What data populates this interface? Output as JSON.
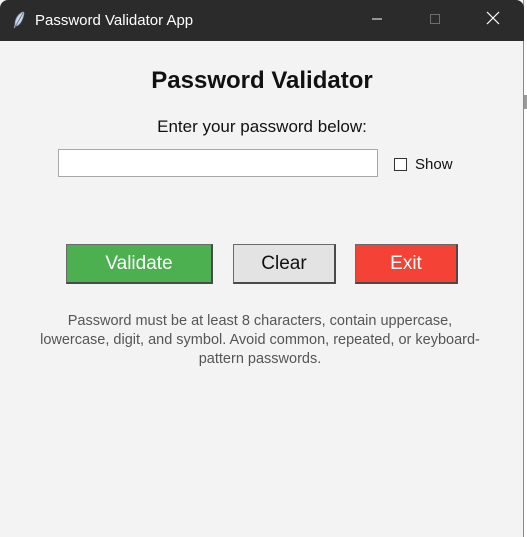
{
  "window": {
    "title": "Password Validator App",
    "icon": "feather-icon",
    "controls": [
      "minimize-icon",
      "maximize-icon",
      "close-icon"
    ]
  },
  "main": {
    "heading": "Password Validator",
    "prompt": "Enter your password below:",
    "password_value": "",
    "show_label": "Show",
    "show_checked": false
  },
  "buttons": {
    "validate": "Validate",
    "clear": "Clear",
    "exit": "Exit"
  },
  "help_text": "Password must be at least 8 characters, contain uppercase, lowercase, digit, and symbol. Avoid common, repeated, or keyboard-pattern passwords.",
  "colors": {
    "titlebar": "#2b2b2b",
    "window_bg": "#f3f3f3",
    "validate_bg": "#4caf50",
    "clear_bg": "#e3e3e3",
    "exit_bg": "#f44336",
    "help_text": "#555555"
  }
}
